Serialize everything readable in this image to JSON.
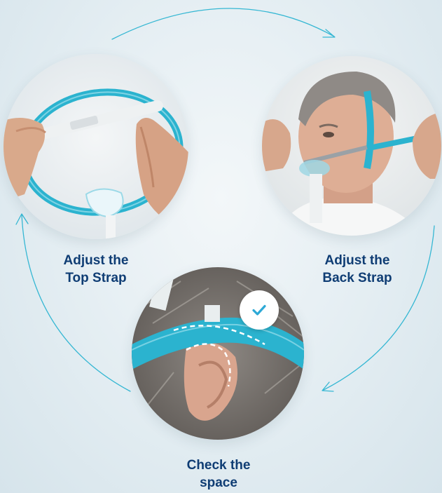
{
  "steps": [
    {
      "label_line1": "Adjust the",
      "label_line2": "Top Strap"
    },
    {
      "label_line1": "Adjust the",
      "label_line2": "Back Strap"
    },
    {
      "label_line1": "Check the",
      "label_line2": "space"
    }
  ],
  "icons": {
    "checkmark": "check-icon",
    "arrows": "cycle-arrow-icon"
  },
  "colors": {
    "label_text": "#0f3d74",
    "strap_teal": "#2bb3cf",
    "arrow_cyan": "#35b7d3",
    "background": "#e3edf2"
  }
}
